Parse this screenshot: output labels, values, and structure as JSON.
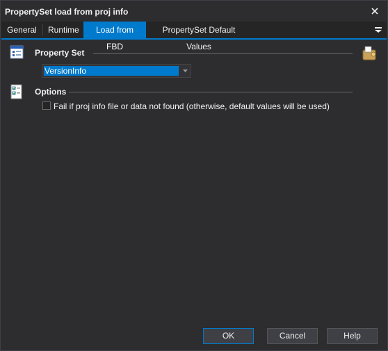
{
  "window": {
    "title": "PropertySet load from proj info"
  },
  "tabs": [
    {
      "label": "General"
    },
    {
      "label": "Runtime"
    },
    {
      "label": "Load from FBD"
    },
    {
      "label": "PropertySet Default Values"
    }
  ],
  "active_tab": "Load from FBD",
  "property_set": {
    "heading": "Property Set",
    "selected": "VersionInfo"
  },
  "options": {
    "heading": "Options",
    "fail_checkbox_label": "Fail if proj info file or data not found (otherwise, default values will be used)",
    "fail_checkbox_checked": false
  },
  "buttons": {
    "ok": "OK",
    "cancel": "Cancel",
    "help": "Help"
  },
  "colors": {
    "accent": "#007acc",
    "background": "#2d2d30"
  }
}
